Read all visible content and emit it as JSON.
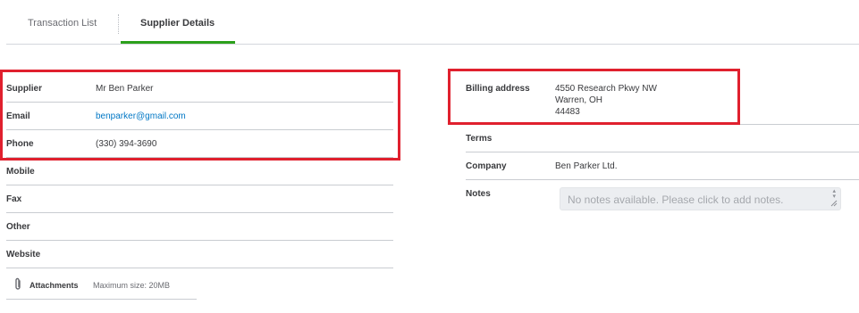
{
  "tabs": [
    {
      "label": "Transaction List"
    },
    {
      "label": "Supplier Details"
    }
  ],
  "details": {
    "supplier": {
      "label": "Supplier",
      "value": "Mr Ben Parker"
    },
    "email": {
      "label": "Email",
      "value": "benparker@gmail.com"
    },
    "phone": {
      "label": "Phone",
      "value": "(330) 394-3690"
    },
    "mobile": {
      "label": "Mobile",
      "value": ""
    },
    "fax": {
      "label": "Fax",
      "value": ""
    },
    "other": {
      "label": "Other",
      "value": ""
    },
    "website": {
      "label": "Website",
      "value": ""
    }
  },
  "attachments": {
    "label": "Attachments",
    "hint": "Maximum size: 20MB"
  },
  "billing": {
    "label": "Billing address",
    "lines": [
      "4550 Research Pkwy NW",
      "Warren, OH",
      "44483"
    ]
  },
  "terms": {
    "label": "Terms",
    "value": ""
  },
  "company": {
    "label": "Company",
    "value": "Ben Parker Ltd."
  },
  "notes": {
    "label": "Notes",
    "placeholder": "No notes available. Please click to add notes."
  },
  "colors": {
    "accent": "#2ca01c",
    "highlight": "#e0202e",
    "link": "#0077c5"
  },
  "icons": {
    "attachment": "paperclip-icon",
    "resize": "resize-grip-icon"
  }
}
